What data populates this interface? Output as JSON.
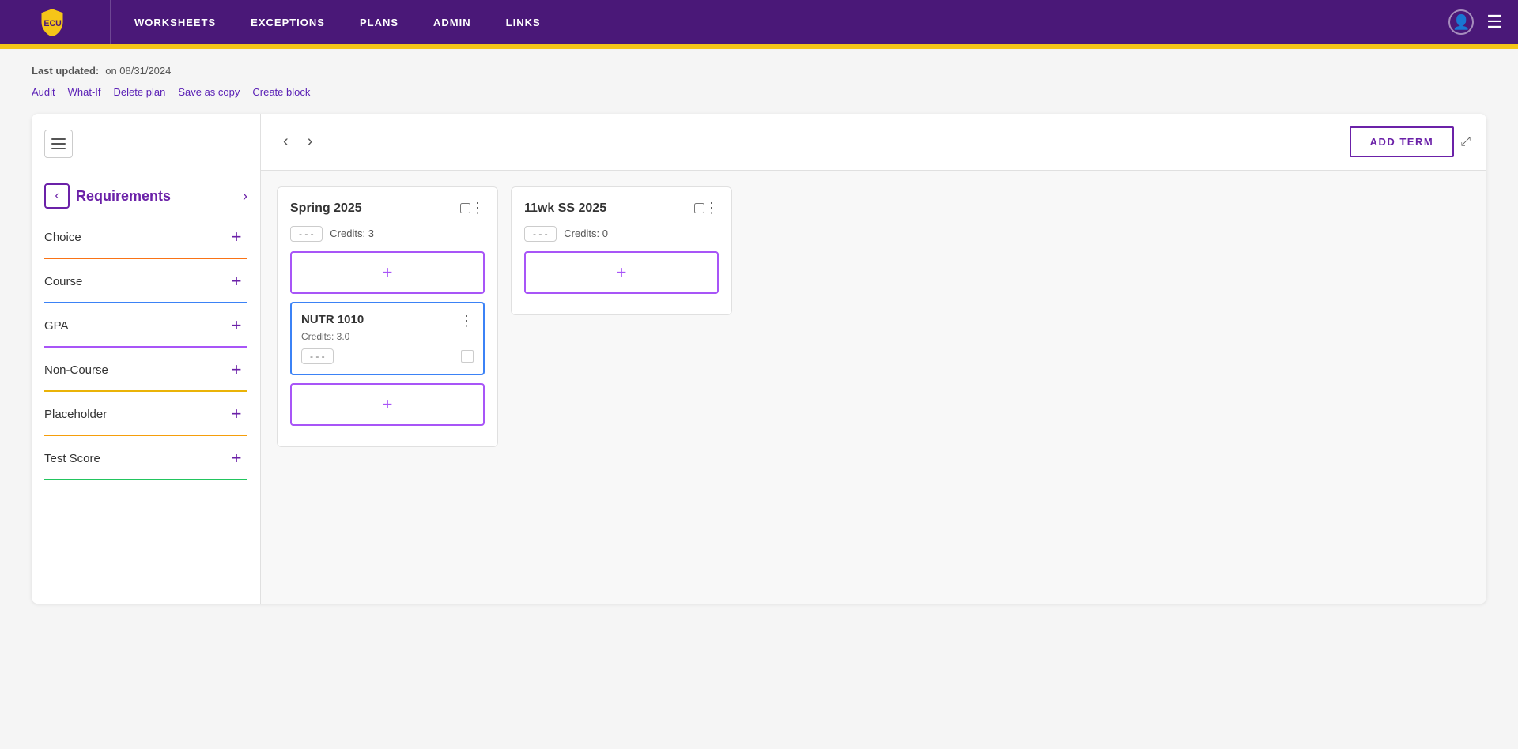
{
  "nav": {
    "logo_text": "ECU",
    "links": [
      "WORKSHEETS",
      "EXCEPTIONS",
      "PLANS",
      "ADMIN",
      "LINKS"
    ],
    "user_icon": "👤",
    "menu_icon": "☰"
  },
  "page": {
    "last_updated_label": "Last updated:",
    "last_updated_date": "on 08/31/2024",
    "action_links": [
      "Audit",
      "What-If",
      "Delete plan",
      "Save as copy",
      "Create block"
    ]
  },
  "toolbar": {
    "prev_label": "‹",
    "next_label": "›",
    "add_term_label": "ADD TERM",
    "expand_label": "⤢"
  },
  "sidebar": {
    "hamburger_label": "☰",
    "back_label": "‹",
    "title": "Requirements",
    "forward_label": "›",
    "items": [
      {
        "id": "choice",
        "label": "Choice",
        "class": "choice"
      },
      {
        "id": "course",
        "label": "Course",
        "class": "course"
      },
      {
        "id": "gpa",
        "label": "GPA",
        "class": "gpa"
      },
      {
        "id": "noncourse",
        "label": "Non-Course",
        "class": "noncourse"
      },
      {
        "id": "placeholder",
        "label": "Placeholder",
        "class": "placeholder"
      },
      {
        "id": "testscore",
        "label": "Test Score",
        "class": "testscore"
      }
    ]
  },
  "terms": [
    {
      "id": "spring2025",
      "title": "Spring 2025",
      "credits_badge": "- - -",
      "credits_label": "Credits:",
      "credits_value": "3",
      "courses": [
        {
          "id": "nutr1010",
          "name": "NUTR 1010",
          "credits": "Credits: 3.0",
          "badge": "- - -"
        }
      ]
    },
    {
      "id": "11wkss2025",
      "title": "11wk SS 2025",
      "credits_badge": "- - -",
      "credits_label": "Credits:",
      "credits_value": "0",
      "courses": []
    }
  ],
  "dots_menu": "⋮",
  "add_icon": "+"
}
